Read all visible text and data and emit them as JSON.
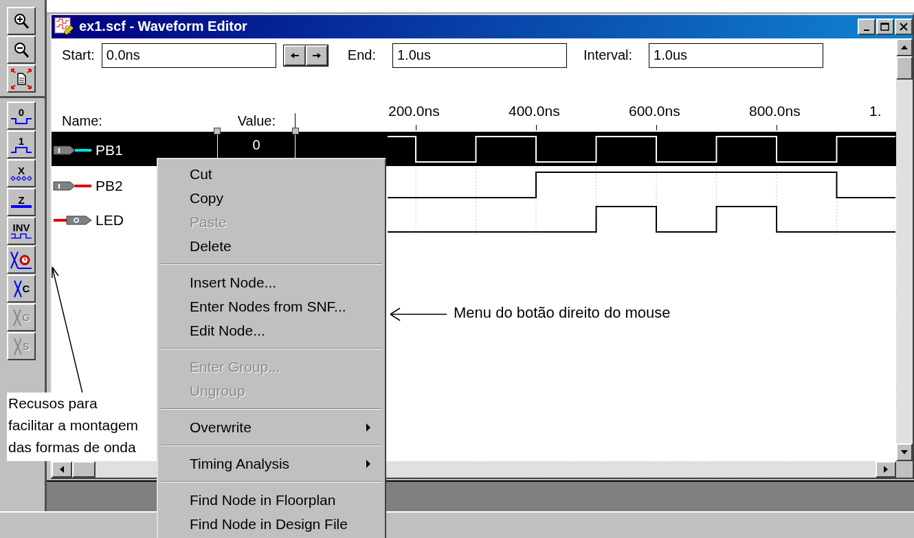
{
  "left_toolbar": [
    {
      "kind": "zoom-in",
      "disabled": false
    },
    {
      "kind": "zoom-out",
      "disabled": false
    },
    {
      "kind": "fit",
      "disabled": false
    },
    {
      "kind": "low",
      "label": "0",
      "disabled": false
    },
    {
      "kind": "high",
      "label": "1",
      "disabled": false
    },
    {
      "kind": "unknown",
      "label": "X",
      "disabled": false
    },
    {
      "kind": "highz",
      "label": "Z",
      "disabled": false
    },
    {
      "kind": "invert",
      "label": "INV",
      "disabled": false
    },
    {
      "kind": "clock",
      "disabled": false
    },
    {
      "kind": "lettered",
      "label": "C",
      "disabled": false
    },
    {
      "kind": "lettered",
      "label": "G",
      "disabled": true
    },
    {
      "kind": "lettered",
      "label": "S",
      "disabled": true
    }
  ],
  "window": {
    "title": "ex1.scf - Waveform Editor"
  },
  "time_bar": {
    "start_label": "Start:",
    "start": "0.0ns",
    "end_label": "End:",
    "end": "1.0us",
    "interval_label": "Interval:",
    "interval": "1.0us"
  },
  "columns": {
    "name": "Name:",
    "value": "Value:"
  },
  "ruler": [
    "200.0ns",
    "400.0ns",
    "600.0ns",
    "800.0ns",
    "1."
  ],
  "signals": [
    {
      "name": "PB1",
      "kind": "input",
      "value": "0",
      "selected": true
    },
    {
      "name": "PB2",
      "kind": "input",
      "selected": false
    },
    {
      "name": "LED",
      "kind": "output",
      "selected": false
    }
  ],
  "context_menu": [
    {
      "kind": "item",
      "label": "Cut",
      "disabled": false
    },
    {
      "kind": "item",
      "label": "Copy",
      "disabled": false
    },
    {
      "kind": "item",
      "label": "Paste",
      "disabled": true
    },
    {
      "kind": "item",
      "label": "Delete",
      "disabled": false
    },
    {
      "kind": "separator"
    },
    {
      "kind": "item",
      "label": "Insert Node...",
      "disabled": false
    },
    {
      "kind": "item",
      "label": "Enter Nodes from SNF...",
      "disabled": false
    },
    {
      "kind": "item",
      "label": "Edit Node...",
      "disabled": false
    },
    {
      "kind": "separator"
    },
    {
      "kind": "item",
      "label": "Enter Group...",
      "disabled": true
    },
    {
      "kind": "item",
      "label": "Ungroup",
      "disabled": true
    },
    {
      "kind": "separator"
    },
    {
      "kind": "submenu",
      "label": "Overwrite",
      "disabled": false
    },
    {
      "kind": "separator"
    },
    {
      "kind": "submenu",
      "label": "Timing Analysis",
      "disabled": false
    },
    {
      "kind": "separator"
    },
    {
      "kind": "item",
      "label": "Find Node in Floorplan",
      "disabled": false
    },
    {
      "kind": "item",
      "label": "Find Node in Design File",
      "disabled": false
    }
  ],
  "annotations": {
    "menu_note": "Menu do botão direito do mouse",
    "toolbar_note": [
      "Recusos para",
      "facilitar a montagem",
      "das formas de onda"
    ]
  }
}
